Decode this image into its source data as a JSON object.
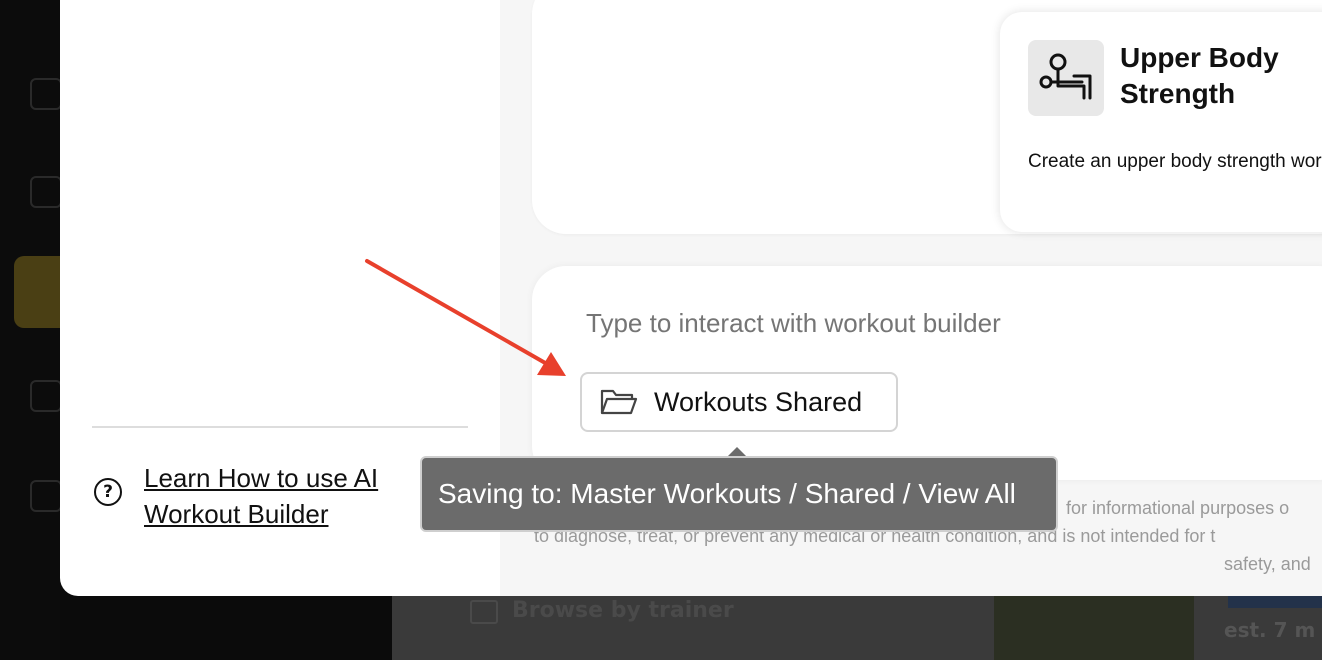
{
  "help": {
    "link_label": "Learn How to use AI Workout Builder",
    "icon": "question-circle-icon"
  },
  "suggestion": {
    "title": "Upper Body Strength",
    "description": "Create an upper body strength workout (Regular) for an interme",
    "icon": "bench-press-icon"
  },
  "composer": {
    "placeholder": "Type to interact with workout builder",
    "folder_label": "Workouts Shared",
    "folder_icon": "folder-open-icon"
  },
  "tooltip": {
    "text": "Saving to: Master Workouts / Shared / View All"
  },
  "disclaimer": {
    "line1": "for informational purposes o",
    "line2": "to diagnose, treat, or prevent any medical or health condition, and is not intended for t",
    "line3": "safety, and"
  },
  "background": {
    "browse_label": "Browse by trainer",
    "side_text": "est. 7 m"
  },
  "colors": {
    "annotation_arrow": "#e8402c",
    "tooltip_bg": "#6b6b6b",
    "accent_active": "#4a3f14"
  }
}
